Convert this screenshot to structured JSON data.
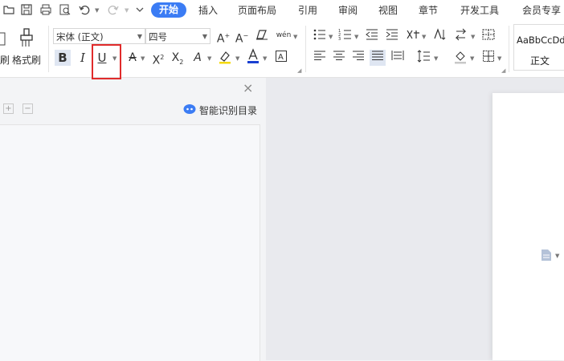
{
  "menu": {
    "tabs": [
      "开始",
      "插入",
      "页面布局",
      "引用",
      "审阅",
      "视图",
      "章节",
      "开发工具",
      "会员专享"
    ]
  },
  "ribbon": {
    "format_painter_label": "格式刷",
    "font_name": "宋体 (正文)",
    "font_size": "四号",
    "bold": "B",
    "italic": "I",
    "underline": "U",
    "style_preview": "AaBbCcDd",
    "style_name": "正文",
    "pinyin_glyph": "wén",
    "left_cut_label": "刷"
  },
  "nav_pane": {
    "smart_toc_label": "智能识别目录",
    "expand": "+",
    "collapse": "−",
    "close": "×"
  },
  "colors": {
    "accent": "#3b7cf4",
    "font_color_bar": "#1a3fd1",
    "highlight_bar": "#f5d90a",
    "annotation": "#e02b2b"
  }
}
